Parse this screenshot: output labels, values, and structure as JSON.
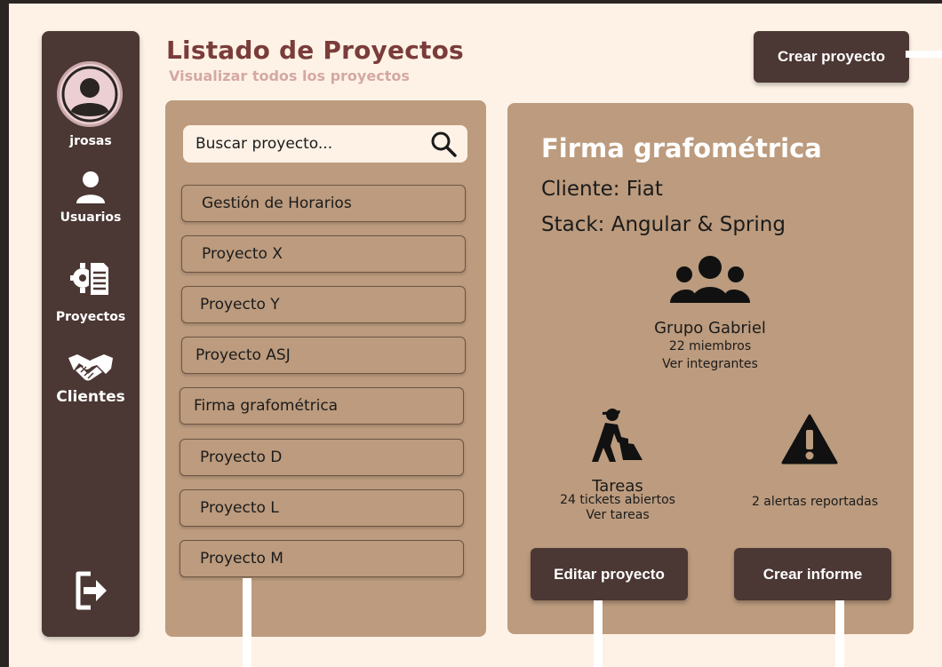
{
  "sidebar": {
    "username": "jrosas",
    "items": [
      {
        "label": "Usuarios",
        "icon": "user-icon"
      },
      {
        "label": "Proyectos",
        "icon": "project-settings-icon"
      },
      {
        "label": "Clientes",
        "icon": "handshake-icon"
      }
    ],
    "logout_icon": "logout-icon"
  },
  "header": {
    "title": "Listado de Proyectos",
    "subtitle": "Visualizar todos los proyectos",
    "create_button": "Crear proyecto"
  },
  "search": {
    "placeholder": "Buscar proyecto..."
  },
  "projects": [
    "Gestión de Horarios",
    "Proyecto X",
    "Proyecto Y",
    "Proyecto ASJ",
    "Firma grafométrica",
    "Proyecto D",
    "Proyecto L",
    "Proyecto M"
  ],
  "detail": {
    "title": "Firma grafométrica",
    "client": "Cliente: Fiat",
    "stack": "Stack: Angular & Spring",
    "group": {
      "name": "Grupo Gabriel",
      "members": "22 miembros",
      "link": "Ver integrantes"
    },
    "tasks": {
      "title": "Tareas",
      "tickets": "24 tickets abiertos",
      "link": "Ver tareas"
    },
    "alerts": "2 alertas reportadas",
    "edit_button": "Editar proyecto",
    "report_button": "Crear informe"
  },
  "colors": {
    "sidebar": "#4b3733",
    "panel": "#bc9b7e",
    "background": "#fef2e6",
    "title": "#7a3c3a",
    "subtitle": "#d4a8a3"
  }
}
